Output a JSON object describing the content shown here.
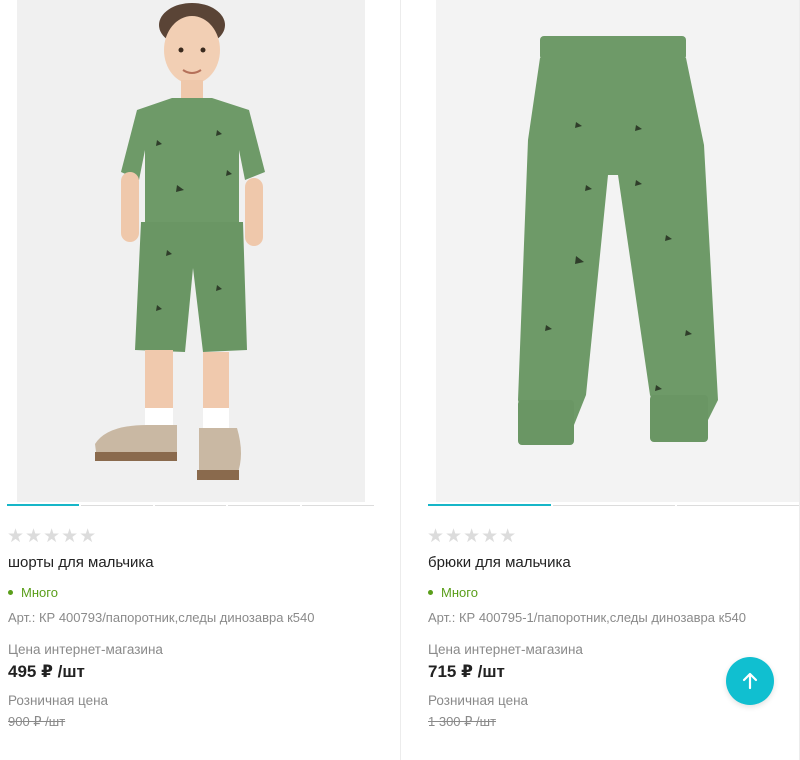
{
  "products": [
    {
      "title": "шорты для мальчика",
      "stock": "Много",
      "article": "Арт.: КР 400793/папоротник,следы динозавра к540",
      "price_label": "Цена интернет-магазина",
      "price": "495 ₽ /шт",
      "retail_label": "Розничная цена",
      "retail_price": "900 ₽ /шт",
      "rating_stars": "★★★★★",
      "image_dots_count": 5,
      "active_dot": 0
    },
    {
      "title": "брюки для мальчика",
      "stock": "Много",
      "article": "Арт.: КР 400795-1/папоротник,следы динозавра к540",
      "price_label": "Цена интернет-магазина",
      "price": "715 ₽ /шт",
      "retail_label": "Розничная цена",
      "retail_price": "1 300 ₽ /шт",
      "rating_stars": "★★★★★",
      "image_dots_count": 3,
      "active_dot": 0
    }
  ],
  "colors": {
    "accent": "#10bfd0",
    "stock_green": "#5a9e1a",
    "garment_green": "#6e9a68"
  },
  "icons": {
    "scroll_top": "arrow-up-icon"
  }
}
